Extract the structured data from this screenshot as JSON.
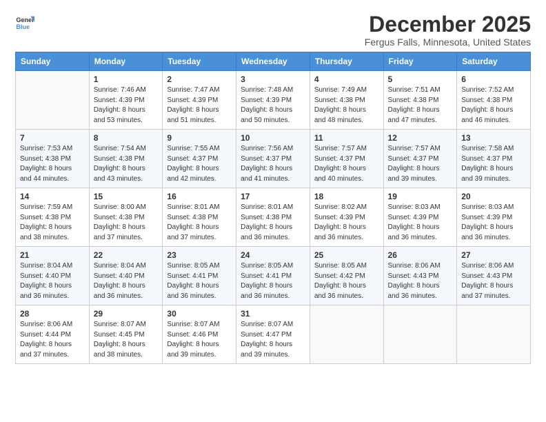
{
  "logo": {
    "line1": "General",
    "line2": "Blue"
  },
  "title": "December 2025",
  "subtitle": "Fergus Falls, Minnesota, United States",
  "days_of_week": [
    "Sunday",
    "Monday",
    "Tuesday",
    "Wednesday",
    "Thursday",
    "Friday",
    "Saturday"
  ],
  "weeks": [
    [
      {
        "day": "",
        "info": ""
      },
      {
        "day": "1",
        "info": "Sunrise: 7:46 AM\nSunset: 4:39 PM\nDaylight: 8 hours\nand 53 minutes."
      },
      {
        "day": "2",
        "info": "Sunrise: 7:47 AM\nSunset: 4:39 PM\nDaylight: 8 hours\nand 51 minutes."
      },
      {
        "day": "3",
        "info": "Sunrise: 7:48 AM\nSunset: 4:39 PM\nDaylight: 8 hours\nand 50 minutes."
      },
      {
        "day": "4",
        "info": "Sunrise: 7:49 AM\nSunset: 4:38 PM\nDaylight: 8 hours\nand 48 minutes."
      },
      {
        "day": "5",
        "info": "Sunrise: 7:51 AM\nSunset: 4:38 PM\nDaylight: 8 hours\nand 47 minutes."
      },
      {
        "day": "6",
        "info": "Sunrise: 7:52 AM\nSunset: 4:38 PM\nDaylight: 8 hours\nand 46 minutes."
      }
    ],
    [
      {
        "day": "7",
        "info": "Sunrise: 7:53 AM\nSunset: 4:38 PM\nDaylight: 8 hours\nand 44 minutes."
      },
      {
        "day": "8",
        "info": "Sunrise: 7:54 AM\nSunset: 4:38 PM\nDaylight: 8 hours\nand 43 minutes."
      },
      {
        "day": "9",
        "info": "Sunrise: 7:55 AM\nSunset: 4:37 PM\nDaylight: 8 hours\nand 42 minutes."
      },
      {
        "day": "10",
        "info": "Sunrise: 7:56 AM\nSunset: 4:37 PM\nDaylight: 8 hours\nand 41 minutes."
      },
      {
        "day": "11",
        "info": "Sunrise: 7:57 AM\nSunset: 4:37 PM\nDaylight: 8 hours\nand 40 minutes."
      },
      {
        "day": "12",
        "info": "Sunrise: 7:57 AM\nSunset: 4:37 PM\nDaylight: 8 hours\nand 39 minutes."
      },
      {
        "day": "13",
        "info": "Sunrise: 7:58 AM\nSunset: 4:37 PM\nDaylight: 8 hours\nand 39 minutes."
      }
    ],
    [
      {
        "day": "14",
        "info": "Sunrise: 7:59 AM\nSunset: 4:38 PM\nDaylight: 8 hours\nand 38 minutes."
      },
      {
        "day": "15",
        "info": "Sunrise: 8:00 AM\nSunset: 4:38 PM\nDaylight: 8 hours\nand 37 minutes."
      },
      {
        "day": "16",
        "info": "Sunrise: 8:01 AM\nSunset: 4:38 PM\nDaylight: 8 hours\nand 37 minutes."
      },
      {
        "day": "17",
        "info": "Sunrise: 8:01 AM\nSunset: 4:38 PM\nDaylight: 8 hours\nand 36 minutes."
      },
      {
        "day": "18",
        "info": "Sunrise: 8:02 AM\nSunset: 4:39 PM\nDaylight: 8 hours\nand 36 minutes."
      },
      {
        "day": "19",
        "info": "Sunrise: 8:03 AM\nSunset: 4:39 PM\nDaylight: 8 hours\nand 36 minutes."
      },
      {
        "day": "20",
        "info": "Sunrise: 8:03 AM\nSunset: 4:39 PM\nDaylight: 8 hours\nand 36 minutes."
      }
    ],
    [
      {
        "day": "21",
        "info": "Sunrise: 8:04 AM\nSunset: 4:40 PM\nDaylight: 8 hours\nand 36 minutes."
      },
      {
        "day": "22",
        "info": "Sunrise: 8:04 AM\nSunset: 4:40 PM\nDaylight: 8 hours\nand 36 minutes."
      },
      {
        "day": "23",
        "info": "Sunrise: 8:05 AM\nSunset: 4:41 PM\nDaylight: 8 hours\nand 36 minutes."
      },
      {
        "day": "24",
        "info": "Sunrise: 8:05 AM\nSunset: 4:41 PM\nDaylight: 8 hours\nand 36 minutes."
      },
      {
        "day": "25",
        "info": "Sunrise: 8:05 AM\nSunset: 4:42 PM\nDaylight: 8 hours\nand 36 minutes."
      },
      {
        "day": "26",
        "info": "Sunrise: 8:06 AM\nSunset: 4:43 PM\nDaylight: 8 hours\nand 36 minutes."
      },
      {
        "day": "27",
        "info": "Sunrise: 8:06 AM\nSunset: 4:43 PM\nDaylight: 8 hours\nand 37 minutes."
      }
    ],
    [
      {
        "day": "28",
        "info": "Sunrise: 8:06 AM\nSunset: 4:44 PM\nDaylight: 8 hours\nand 37 minutes."
      },
      {
        "day": "29",
        "info": "Sunrise: 8:07 AM\nSunset: 4:45 PM\nDaylight: 8 hours\nand 38 minutes."
      },
      {
        "day": "30",
        "info": "Sunrise: 8:07 AM\nSunset: 4:46 PM\nDaylight: 8 hours\nand 39 minutes."
      },
      {
        "day": "31",
        "info": "Sunrise: 8:07 AM\nSunset: 4:47 PM\nDaylight: 8 hours\nand 39 minutes."
      },
      {
        "day": "",
        "info": ""
      },
      {
        "day": "",
        "info": ""
      },
      {
        "day": "",
        "info": ""
      }
    ]
  ]
}
